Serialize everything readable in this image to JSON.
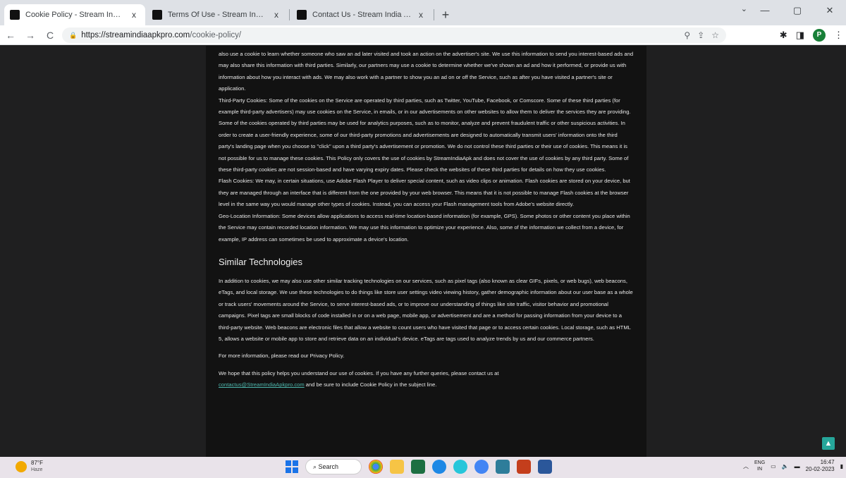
{
  "browser": {
    "tabs": [
      {
        "title": "Cookie Policy - Stream India Apk",
        "active": true
      },
      {
        "title": "Terms Of Use - Stream India Apk",
        "active": false
      },
      {
        "title": "Contact Us - Stream India Apk D",
        "active": false
      }
    ],
    "new_tab_label": "+",
    "close_label": "x",
    "window_controls": {
      "minimize": "—",
      "maximize": "▢",
      "close": "✕"
    },
    "tab_search": "⌄",
    "url_host": "https://streamindiaapkpro.com",
    "url_path": "/cookie-policy/"
  },
  "article": {
    "p_ads": "also use a cookie to learn whether someone who saw an ad later visited and took an action on the advertiser's site. We use this information to send you interest-based ads and may also share this information with third parties. Similarly, our partners may use a cookie to determine whether we've shown an ad and how it performed, or provide us with information about how you interact with ads. We may also work with a partner to show you an ad on or off the Service, such as after you have visited a partner's site or application.",
    "p_third_party": "Third-Party Cookies: Some of the cookies on the Service are operated by third parties, such as Twitter, YouTube, Facebook, or Comscore. Some of these third parties (for example third-party advertisers) may use cookies on the Service, in emails, or in our advertisements on other websites to allow them to deliver the services they are providing. Some of the cookies operated by third parties may be used for analytics purposes, such as to monitor, analyze and prevent fraudulent traffic or other suspicious activities. In order to create a user-friendly experience, some of our third-party promotions and advertisements are designed to automatically transmit users' information onto the third party's landing page when you choose to \"click\" upon a third party's advertisement or promotion. We do not control these third parties or their use of cookies. This means it is not possible for us to manage these cookies. This Policy only covers the use of cookies by StreamIndiaApk and does not cover the use of cookies by any third party. Some of these third-party cookies are not session-based and have varying expiry dates. Please check the websites of these third parties for details on how they use cookies.",
    "p_flash": "Flash Cookies: We may, in certain situations, use Adobe Flash Player to deliver special content, such as video clips or animation. Flash cookies are stored on your device, but they are managed through an interface that is different from the one provided by your web browser. This means that it is not possible to manage Flash cookies at the browser level in the same way you would manage other types of cookies. Instead, you can access your Flash management tools from Adobe's website directly.",
    "p_geo": "Geo-Location Information: Some devices allow applications to access real-time location-based information (for example, GPS). Some photos or other content you place within the Service may contain recorded location information. We may use this information to optimize your experience. Also, some of the information we collect from a device, for example, IP address can sometimes be used to approximate a device's location.",
    "heading_similar": "Similar Technologies",
    "p_similar": "In addition to cookies, we may also use other similar tracking technologies on our services, such as pixel tags (also known as clear GIFs, pixels, or web bugs), web beacons, eTags, and local storage. We use these technologies to do things like store user settings video viewing history, gather demographic information about our user base as a whole or track users' movements around the Service, to serve interest-based ads, or to improve our understanding of things like site traffic, visitor behavior and promotional campaigns. Pixel tags are small blocks of code installed in or on a web page, mobile app, or advertisement and are a method for passing information from your device to a third-party website. Web beacons are electronic files that allow a website to count users who have visited that page or to access certain cookies. Local storage, such as HTML 5, allows a website or mobile app to store and retrieve data on an individual's device. eTags are tags used to analyze trends by us and our commerce partners.",
    "p_more_info": "For more information, please read our Privacy Policy.",
    "p_hope_1": "We hope that this policy helps you understand our use of cookies. If you have any further queries, please contact us at",
    "contact_email": "contactus@StreamIndiaApkpro.com",
    "p_hope_2": " and be sure to include Cookie Policy in the subject line.",
    "scroll_top_icon": "▲"
  },
  "taskbar": {
    "weather_temp": "87°F",
    "weather_desc": "Haze",
    "search_label": "Search",
    "lang_1": "ENG",
    "lang_2": "IN",
    "time": "16:47",
    "date": "20-02-2023",
    "icons": [
      "windows-start-icon",
      "chrome-icon",
      "file-explorer-icon",
      "excel-icon",
      "edge-icon",
      "settings-icon",
      "chrome-profile-icon",
      "photos-icon",
      "powerpoint-icon",
      "word-icon"
    ]
  }
}
